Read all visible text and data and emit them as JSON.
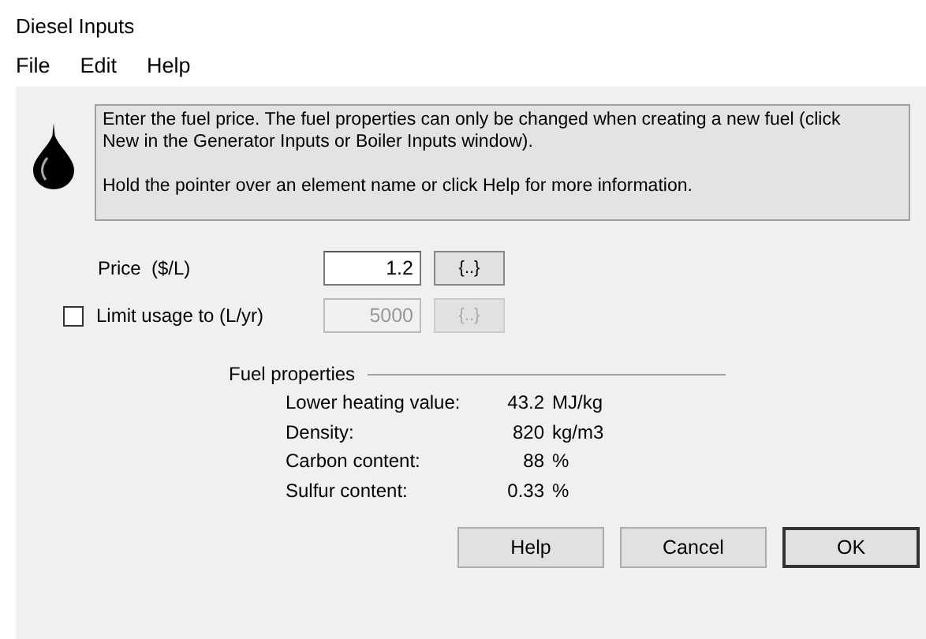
{
  "window": {
    "title": "Diesel Inputs"
  },
  "menu": [
    "File",
    "Edit",
    "Help"
  ],
  "info": {
    "paragraphs": [
      "Enter the fuel price. The fuel properties can only be changed when creating a new fuel (click New in the Generator Inputs or Boiler Inputs window).",
      "Hold the pointer over an element name or click Help for more information."
    ]
  },
  "inputs": [
    {
      "label": "Price  ($/L)",
      "value": "1.2",
      "button": "{..}",
      "kind": "plain",
      "disabled": false
    },
    {
      "label": "Limit usage to (L/yr)",
      "value": "5000",
      "button": "{..}",
      "kind": "checkbox",
      "checked": false,
      "disabled": true
    }
  ],
  "fuel_properties": {
    "title": "Fuel properties",
    "rows": [
      {
        "label": "Lower heating value:",
        "value": "43.2",
        "unit": "MJ/kg"
      },
      {
        "label": "Density:",
        "value": "820",
        "unit": "kg/m3"
      },
      {
        "label": "Carbon content:",
        "value": "88",
        "unit": "%"
      },
      {
        "label": "Sulfur content:",
        "value": "0.33",
        "unit": "%"
      }
    ]
  },
  "buttons": [
    {
      "label": "Help",
      "default": false
    },
    {
      "label": "Cancel",
      "default": false
    },
    {
      "label": "OK",
      "default": true
    }
  ]
}
